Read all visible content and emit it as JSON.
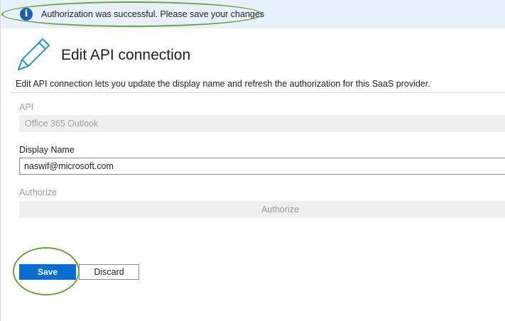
{
  "banner": {
    "icon": "info-icon",
    "icon_glyph": "i",
    "message": "Authorization was successful. Please save your changes"
  },
  "header": {
    "icon": "pencil-icon",
    "title": "Edit API connection",
    "description": "Edit API connection lets you update the display name and refresh the authorization for this SaaS provider."
  },
  "form": {
    "api": {
      "label": "API",
      "value": "Office 365 Outlook"
    },
    "display_name": {
      "label": "Display Name",
      "value": "naswif@microsoft.com"
    },
    "authorize": {
      "label": "Authorize",
      "button_label": "Authorize"
    }
  },
  "actions": {
    "save_label": "Save",
    "discard_label": "Discard"
  },
  "colors": {
    "banner_bg": "#e7f0fb",
    "info_icon": "#1a5fb4",
    "primary_button": "#0a6ed1",
    "highlight_annotation": "#6aa33a",
    "pencil_icon": "#2e9bd6"
  }
}
